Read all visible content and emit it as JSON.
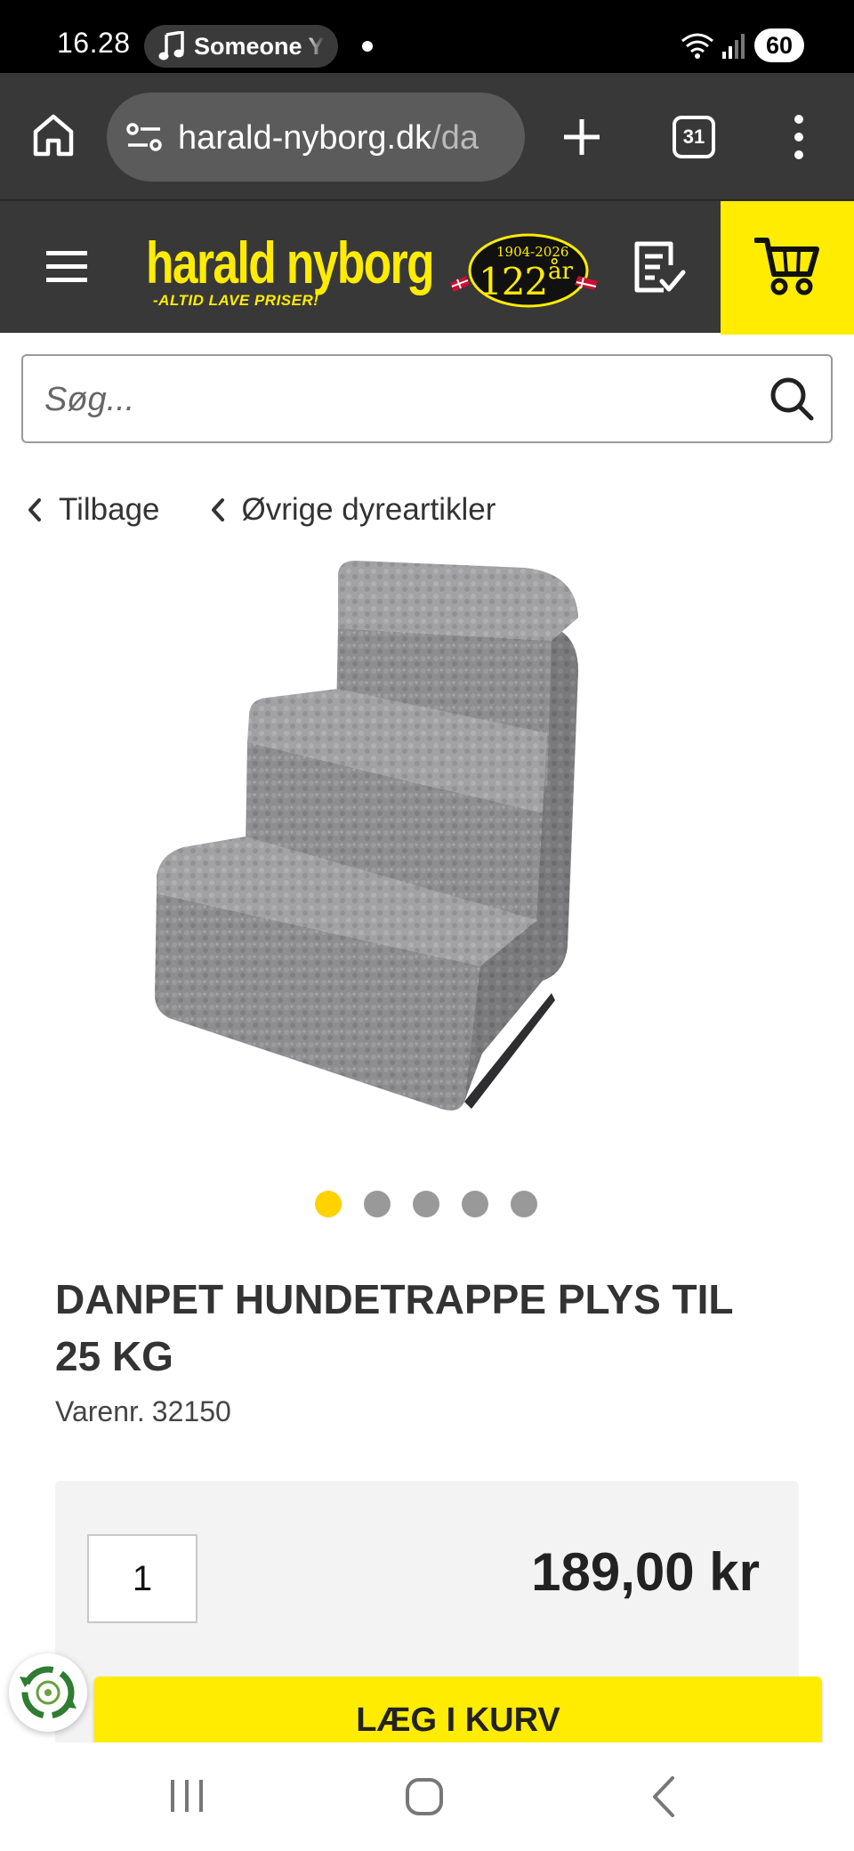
{
  "status_bar": {
    "time": "16.28",
    "media_text": "Someone Y",
    "battery": "60",
    "icons": [
      "music-note-icon",
      "wifi-icon",
      "signal-icon"
    ]
  },
  "browser": {
    "url_host": "harald-nyborg.dk",
    "url_path": "/da",
    "tab_count": "31",
    "icons": [
      "home-icon",
      "site-settings-icon",
      "new-tab-icon",
      "tabs-icon",
      "menu-dots-icon"
    ]
  },
  "header": {
    "logo_name": "harald nyborg",
    "logo_tagline": "-ALTID LAVE PRISER!",
    "anniversary_years": "1904-2026",
    "anniversary_number": "122",
    "anniversary_unit": "år",
    "icons": [
      "hamburger-icon",
      "shopping-list-icon",
      "cart-icon"
    ],
    "colors": {
      "brand_yellow": "#ffec00",
      "header_bg": "#383838"
    }
  },
  "search": {
    "placeholder": "Søg..."
  },
  "breadcrumbs": {
    "back_label": "Tilbage",
    "category_label": "Øvrige dyreartikler"
  },
  "carousel": {
    "image_count": 5,
    "active_index": 0
  },
  "product": {
    "title": "DANPET HUNDETRAPPE PLYS TIL 25 KG",
    "sku_label": "Varenr.",
    "sku_value": "32150",
    "quantity": "1",
    "price": "189,00 kr",
    "add_to_cart_label": "LÆG I KURV"
  },
  "navigation": {
    "icons": [
      "recents-icon",
      "home-circle-icon",
      "back-chevron-icon"
    ]
  }
}
